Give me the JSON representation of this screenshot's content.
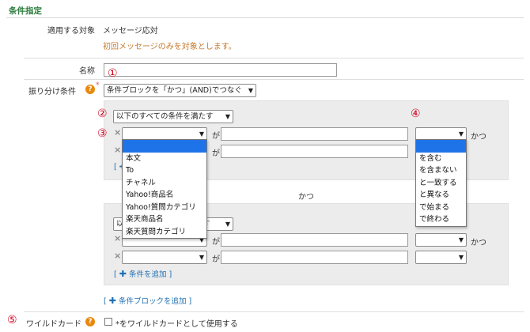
{
  "section_title": "条件指定",
  "target": {
    "label": "適用する対象",
    "value": "メッセージ応対",
    "note": "初回メッセージのみを対象とします。"
  },
  "name_field": {
    "label": "名称",
    "value": "",
    "placeholder": ""
  },
  "routing": {
    "label": "振り分け条件",
    "required_mark": "*",
    "help_icon": "?",
    "mode_selected": "条件ブロックを「かつ」(AND)でつなぐ"
  },
  "markers": {
    "m1": "①",
    "m2": "②",
    "m3": "③",
    "m4": "④",
    "m5": "⑤"
  },
  "block1": {
    "match_selected": "以下のすべての条件を満たす",
    "rows": [
      {
        "remove": "×",
        "field": "",
        "ga": "が",
        "value": "",
        "op": "",
        "kat": "かつ"
      },
      {
        "remove": "×",
        "field": "",
        "ga": "が",
        "value": "",
        "op": ""
      }
    ],
    "add_partial": "[ ✚"
  },
  "field_dropdown": {
    "options": [
      "",
      "本文",
      "To",
      "チャネル",
      "Yahoo!商品名",
      "Yahoo!質問カテゴリ",
      "楽天商品名",
      "楽天質問カテゴリ"
    ]
  },
  "op_dropdown": {
    "options": [
      "",
      "を含む",
      "を含まない",
      "と一致する",
      "と異なる",
      "で始まる",
      "で終わる"
    ]
  },
  "between_blocks": "かつ",
  "block2": {
    "match_selected_left": "以",
    "match_selected_right": "す",
    "rows": [
      {
        "remove": "×",
        "field": "",
        "ga": "が",
        "value": "",
        "op": "",
        "kat": "かつ"
      },
      {
        "remove": "×",
        "field": "",
        "ga": "が",
        "value": "",
        "op": ""
      }
    ],
    "add_condition": "条件を追加",
    "bracket_open": "[",
    "bracket_close": "]"
  },
  "add_block": {
    "label": "条件ブロックを追加",
    "bracket_open": "[",
    "bracket_close": "]"
  },
  "wildcard": {
    "label": "ワイルドカード",
    "help_icon": "?",
    "checkbox_label": "*をワイルドカードとして使用する"
  },
  "colors": {
    "title_green": "#2e7d3e",
    "note_orange": "#c47a2c",
    "link_blue": "#1f6fb2",
    "marker_red": "#d0021b",
    "help_orange": "#e8890c",
    "highlight": "#1e73e8"
  }
}
